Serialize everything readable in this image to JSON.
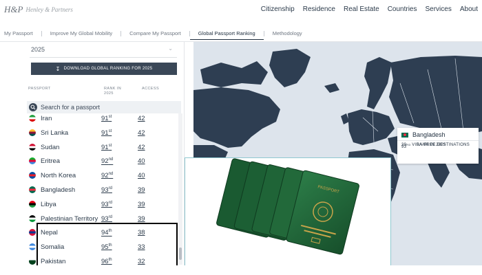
{
  "brand": {
    "mark": "H&P",
    "name": "Henley & Partners"
  },
  "main_nav": [
    "Citizenship",
    "Residence",
    "Real Estate",
    "Countries",
    "Services",
    "About"
  ],
  "sub_nav": [
    {
      "label": "My Passport",
      "active": false
    },
    {
      "label": "Improve My Global Mobility",
      "active": false
    },
    {
      "label": "Compare My Passport",
      "active": false
    },
    {
      "label": "Global Passport Ranking",
      "active": true
    },
    {
      "label": "Methodology",
      "active": false
    }
  ],
  "panel": {
    "year": "2025",
    "download_label": "DOWNLOAD GLOBAL RANKING FOR 2025",
    "columns": {
      "passport": "PASSPORT",
      "rank_line1": "RANK IN",
      "rank_line2": "2025",
      "access": "ACCESS"
    },
    "search_placeholder": "Search for a passport",
    "rows": [
      {
        "country": "Iran",
        "rank": "91",
        "suffix": "st",
        "access": "42",
        "flag": [
          "#239f40",
          "#ffffff",
          "#da0000"
        ]
      },
      {
        "country": "Sri Lanka",
        "rank": "91",
        "suffix": "st",
        "access": "42",
        "flag": [
          "#ffbe29",
          "#8d153a",
          "#00534e"
        ]
      },
      {
        "country": "Sudan",
        "rank": "91",
        "suffix": "st",
        "access": "42",
        "flag": [
          "#d21034",
          "#ffffff",
          "#000000"
        ]
      },
      {
        "country": "Eritrea",
        "rank": "92",
        "suffix": "nd",
        "access": "40",
        "flag": [
          "#12ad2b",
          "#ea0437",
          "#4189dd"
        ]
      },
      {
        "country": "North Korea",
        "rank": "92",
        "suffix": "nd",
        "access": "40",
        "flag": [
          "#024fa2",
          "#ed1c27",
          "#024fa2"
        ]
      },
      {
        "country": "Bangladesh",
        "rank": "93",
        "suffix": "rd",
        "access": "39",
        "flag": [
          "#006a4e",
          "#f42a41",
          "#006a4e"
        ]
      },
      {
        "country": "Libya",
        "rank": "93",
        "suffix": "rd",
        "access": "39",
        "flag": [
          "#e70013",
          "#000000",
          "#239e46"
        ]
      },
      {
        "country": "Palestinian Territory",
        "rank": "93",
        "suffix": "rd",
        "access": "39",
        "flag": [
          "#000000",
          "#ffffff",
          "#009736"
        ]
      },
      {
        "country": "Nepal",
        "rank": "94",
        "suffix": "th",
        "access": "38",
        "flag": [
          "#dc143c",
          "#003893",
          "#dc143c"
        ]
      },
      {
        "country": "Somalia",
        "rank": "95",
        "suffix": "th",
        "access": "33",
        "flag": [
          "#4189dd",
          "#ffffff",
          "#4189dd"
        ]
      },
      {
        "country": "Pakistan",
        "rank": "96",
        "suffix": "th",
        "access": "32",
        "flag": [
          "#ffffff",
          "#01411c",
          "#01411c"
        ]
      }
    ]
  },
  "map_card": {
    "country": "Bangladesh",
    "rank_value": "93",
    "rank_suffix": "RD",
    "rank_label": "RANK IN 2025",
    "access_value": "39",
    "access_label": "VISA-FREE DESTINATIONS"
  },
  "colors": {
    "navy": "#3a4757",
    "map_land": "#2e3e52",
    "map_sea": "#dde4ec",
    "passport_green": "#1f6b3a",
    "highlight": "#000000"
  }
}
